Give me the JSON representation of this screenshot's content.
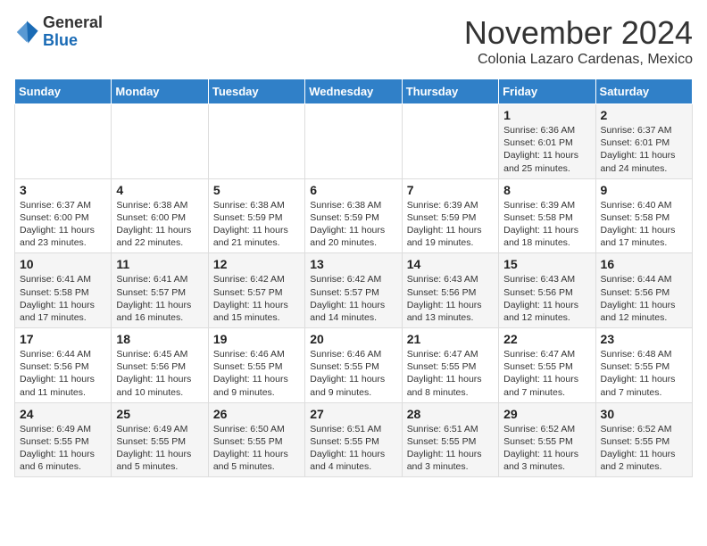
{
  "logo": {
    "general": "General",
    "blue": "Blue"
  },
  "title": "November 2024",
  "location": "Colonia Lazaro Cardenas, Mexico",
  "days_of_week": [
    "Sunday",
    "Monday",
    "Tuesday",
    "Wednesday",
    "Thursday",
    "Friday",
    "Saturday"
  ],
  "weeks": [
    [
      {
        "day": "",
        "info": ""
      },
      {
        "day": "",
        "info": ""
      },
      {
        "day": "",
        "info": ""
      },
      {
        "day": "",
        "info": ""
      },
      {
        "day": "",
        "info": ""
      },
      {
        "day": "1",
        "info": "Sunrise: 6:36 AM\nSunset: 6:01 PM\nDaylight: 11 hours and 25 minutes."
      },
      {
        "day": "2",
        "info": "Sunrise: 6:37 AM\nSunset: 6:01 PM\nDaylight: 11 hours and 24 minutes."
      }
    ],
    [
      {
        "day": "3",
        "info": "Sunrise: 6:37 AM\nSunset: 6:00 PM\nDaylight: 11 hours and 23 minutes."
      },
      {
        "day": "4",
        "info": "Sunrise: 6:38 AM\nSunset: 6:00 PM\nDaylight: 11 hours and 22 minutes."
      },
      {
        "day": "5",
        "info": "Sunrise: 6:38 AM\nSunset: 5:59 PM\nDaylight: 11 hours and 21 minutes."
      },
      {
        "day": "6",
        "info": "Sunrise: 6:38 AM\nSunset: 5:59 PM\nDaylight: 11 hours and 20 minutes."
      },
      {
        "day": "7",
        "info": "Sunrise: 6:39 AM\nSunset: 5:59 PM\nDaylight: 11 hours and 19 minutes."
      },
      {
        "day": "8",
        "info": "Sunrise: 6:39 AM\nSunset: 5:58 PM\nDaylight: 11 hours and 18 minutes."
      },
      {
        "day": "9",
        "info": "Sunrise: 6:40 AM\nSunset: 5:58 PM\nDaylight: 11 hours and 17 minutes."
      }
    ],
    [
      {
        "day": "10",
        "info": "Sunrise: 6:41 AM\nSunset: 5:58 PM\nDaylight: 11 hours and 17 minutes."
      },
      {
        "day": "11",
        "info": "Sunrise: 6:41 AM\nSunset: 5:57 PM\nDaylight: 11 hours and 16 minutes."
      },
      {
        "day": "12",
        "info": "Sunrise: 6:42 AM\nSunset: 5:57 PM\nDaylight: 11 hours and 15 minutes."
      },
      {
        "day": "13",
        "info": "Sunrise: 6:42 AM\nSunset: 5:57 PM\nDaylight: 11 hours and 14 minutes."
      },
      {
        "day": "14",
        "info": "Sunrise: 6:43 AM\nSunset: 5:56 PM\nDaylight: 11 hours and 13 minutes."
      },
      {
        "day": "15",
        "info": "Sunrise: 6:43 AM\nSunset: 5:56 PM\nDaylight: 11 hours and 12 minutes."
      },
      {
        "day": "16",
        "info": "Sunrise: 6:44 AM\nSunset: 5:56 PM\nDaylight: 11 hours and 12 minutes."
      }
    ],
    [
      {
        "day": "17",
        "info": "Sunrise: 6:44 AM\nSunset: 5:56 PM\nDaylight: 11 hours and 11 minutes."
      },
      {
        "day": "18",
        "info": "Sunrise: 6:45 AM\nSunset: 5:56 PM\nDaylight: 11 hours and 10 minutes."
      },
      {
        "day": "19",
        "info": "Sunrise: 6:46 AM\nSunset: 5:55 PM\nDaylight: 11 hours and 9 minutes."
      },
      {
        "day": "20",
        "info": "Sunrise: 6:46 AM\nSunset: 5:55 PM\nDaylight: 11 hours and 9 minutes."
      },
      {
        "day": "21",
        "info": "Sunrise: 6:47 AM\nSunset: 5:55 PM\nDaylight: 11 hours and 8 minutes."
      },
      {
        "day": "22",
        "info": "Sunrise: 6:47 AM\nSunset: 5:55 PM\nDaylight: 11 hours and 7 minutes."
      },
      {
        "day": "23",
        "info": "Sunrise: 6:48 AM\nSunset: 5:55 PM\nDaylight: 11 hours and 7 minutes."
      }
    ],
    [
      {
        "day": "24",
        "info": "Sunrise: 6:49 AM\nSunset: 5:55 PM\nDaylight: 11 hours and 6 minutes."
      },
      {
        "day": "25",
        "info": "Sunrise: 6:49 AM\nSunset: 5:55 PM\nDaylight: 11 hours and 5 minutes."
      },
      {
        "day": "26",
        "info": "Sunrise: 6:50 AM\nSunset: 5:55 PM\nDaylight: 11 hours and 5 minutes."
      },
      {
        "day": "27",
        "info": "Sunrise: 6:51 AM\nSunset: 5:55 PM\nDaylight: 11 hours and 4 minutes."
      },
      {
        "day": "28",
        "info": "Sunrise: 6:51 AM\nSunset: 5:55 PM\nDaylight: 11 hours and 3 minutes."
      },
      {
        "day": "29",
        "info": "Sunrise: 6:52 AM\nSunset: 5:55 PM\nDaylight: 11 hours and 3 minutes."
      },
      {
        "day": "30",
        "info": "Sunrise: 6:52 AM\nSunset: 5:55 PM\nDaylight: 11 hours and 2 minutes."
      }
    ]
  ]
}
